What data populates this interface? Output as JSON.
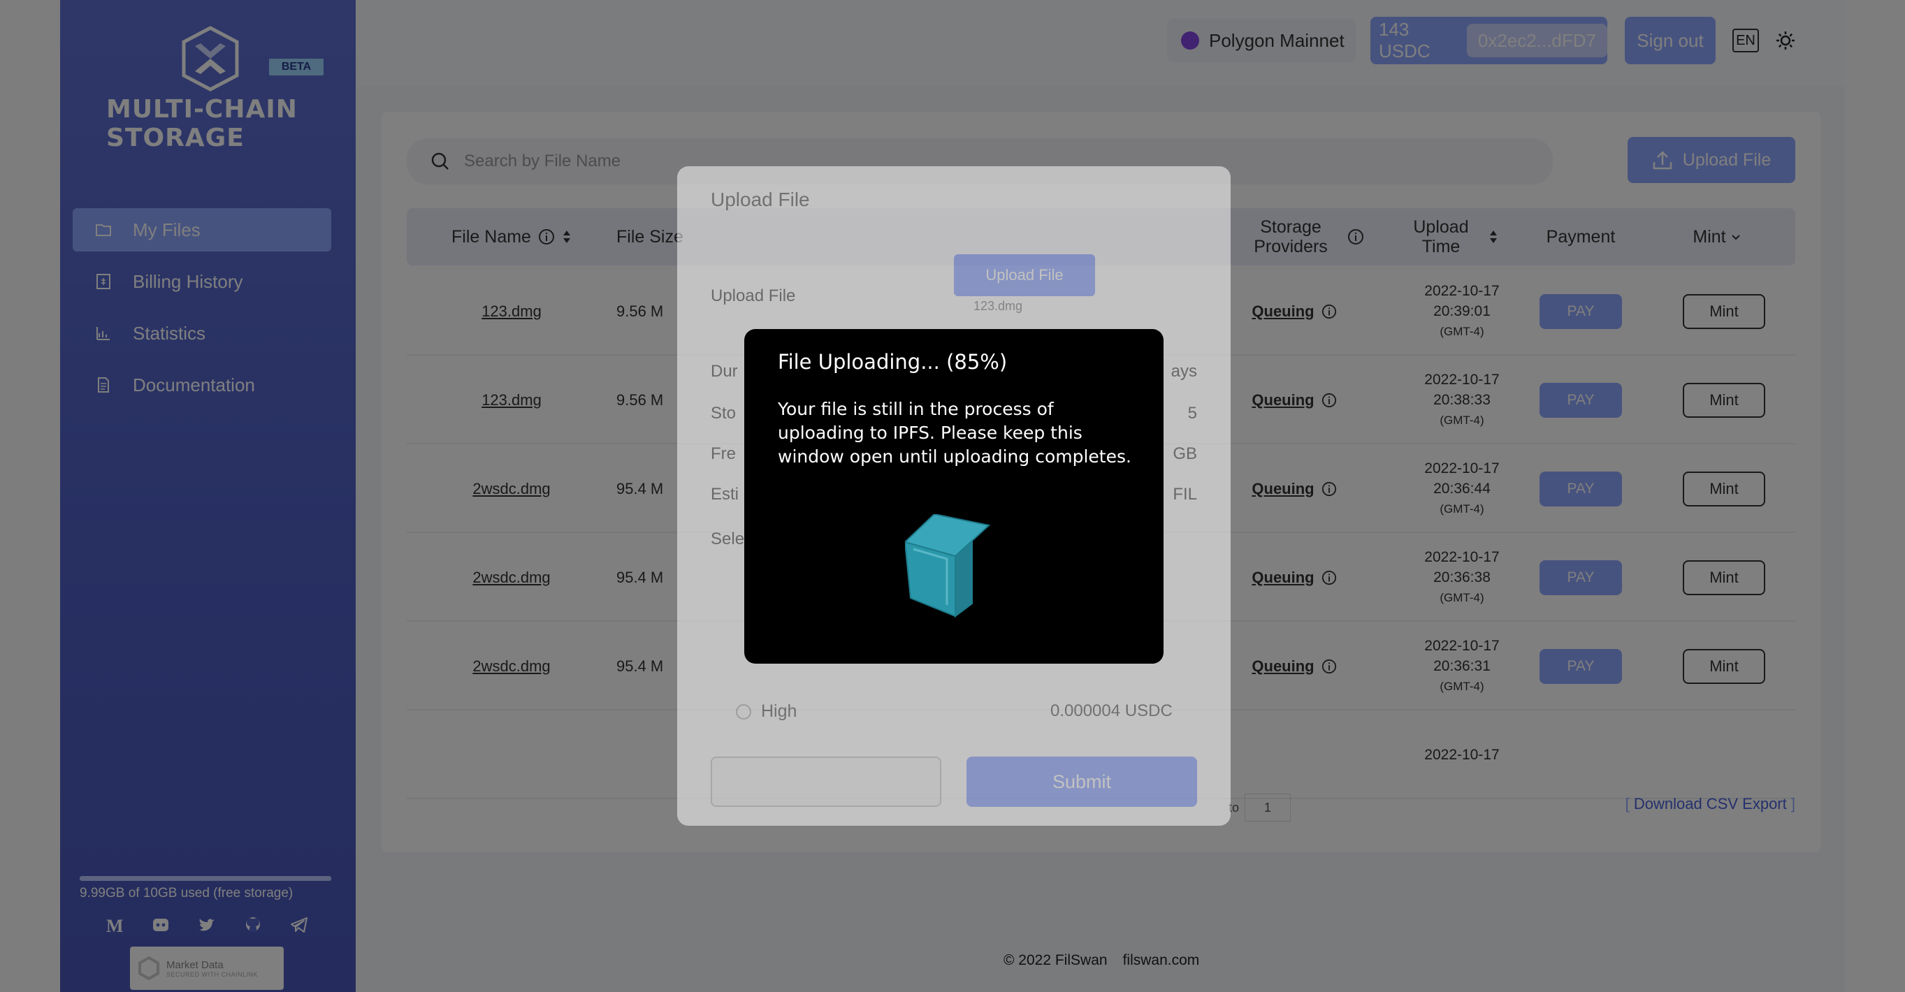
{
  "app": {
    "brand_line1": "MULTI-CHAIN",
    "brand_line2": "STORAGE",
    "beta_badge": "BETA"
  },
  "sidebar": {
    "items": [
      {
        "label": "My Files",
        "icon": "folder-icon",
        "active": true
      },
      {
        "label": "Billing History",
        "icon": "receipt-icon",
        "active": false
      },
      {
        "label": "Statistics",
        "icon": "chart-icon",
        "active": false
      },
      {
        "label": "Documentation",
        "icon": "document-icon",
        "active": false
      }
    ],
    "storage": {
      "used_fraction": 0.999,
      "text": "9.99GB of 10GB used (free storage)"
    },
    "socials": [
      "medium-icon",
      "discord-icon",
      "twitter-icon",
      "github-icon",
      "telegram-icon"
    ],
    "chainlink": {
      "line1": "Market Data",
      "line2": "SECURED WITH CHAINLINK"
    }
  },
  "header": {
    "network": "Polygon Mainnet",
    "balance": "143 USDC",
    "address": "0x2ec2...dFD7",
    "sign_out": "Sign out",
    "language": "EN"
  },
  "files": {
    "search_placeholder": "Search by File Name",
    "upload_button": "Upload File",
    "columns": {
      "file_name": "File Name",
      "file_size": "File Size",
      "storage_providers": "Storage Providers",
      "upload_time": "Upload Time",
      "payment": "Payment",
      "mint": "Mint"
    },
    "rows": [
      {
        "name": "123.dmg",
        "size": "9.56 M",
        "status": "Queuing",
        "date": "2022-10-17",
        "time": "20:39:01",
        "tz": "(GMT-4)",
        "pay": "PAY",
        "mint": "Mint"
      },
      {
        "name": "123.dmg",
        "size": "9.56 M",
        "status": "Queuing",
        "date": "2022-10-17",
        "time": "20:38:33",
        "tz": "(GMT-4)",
        "pay": "PAY",
        "mint": "Mint"
      },
      {
        "name": "2wsdc.dmg",
        "size": "95.4 M",
        "status": "Queuing",
        "date": "2022-10-17",
        "time": "20:36:44",
        "tz": "(GMT-4)",
        "pay": "PAY",
        "mint": "Mint"
      },
      {
        "name": "2wsdc.dmg",
        "size": "95.4 M",
        "status": "Queuing",
        "date": "2022-10-17",
        "time": "20:36:38",
        "tz": "(GMT-4)",
        "pay": "PAY",
        "mint": "Mint"
      },
      {
        "name": "2wsdc.dmg",
        "size": "95.4 M",
        "status": "Queuing",
        "date": "2022-10-17",
        "time": "20:36:31",
        "tz": "(GMT-4)",
        "pay": "PAY",
        "mint": "Mint"
      },
      {
        "name": "",
        "size": "",
        "status": "",
        "date": "2022-10-17",
        "time": "",
        "tz": "",
        "pay": "",
        "mint": ""
      }
    ],
    "go_to_label": "to",
    "go_to_page": "1",
    "csv_open": "[",
    "csv_label": "Download CSV Export",
    "csv_close": "]"
  },
  "footer": {
    "copyright": "© 2022 FilSwan",
    "site": "filswan.com"
  },
  "upload_dialog": {
    "title": "Upload File",
    "upload_label": "Upload File",
    "upload_button": "Upload File",
    "file_name": "123.dmg",
    "rows": [
      {
        "label": "Dur",
        "value": "ays"
      },
      {
        "label": "Sto",
        "value": "5"
      },
      {
        "label": "Fre",
        "value": "GB"
      },
      {
        "label": "Esti",
        "value": "FIL"
      },
      {
        "label": "Sele",
        "value": ""
      }
    ],
    "high_label": "High",
    "high_value": "0.000004 USDC",
    "submit": "Submit"
  },
  "upload_progress": {
    "progress_percent": 85,
    "title": "File Uploading... (85%)",
    "message": "Your file is still in the process of uploading to IPFS. Please keep this window open until uploading completes."
  },
  "colors": {
    "accent": "#8fa6ff",
    "sidebar": "#5565c9",
    "loader_box": "#2a9bb0"
  }
}
